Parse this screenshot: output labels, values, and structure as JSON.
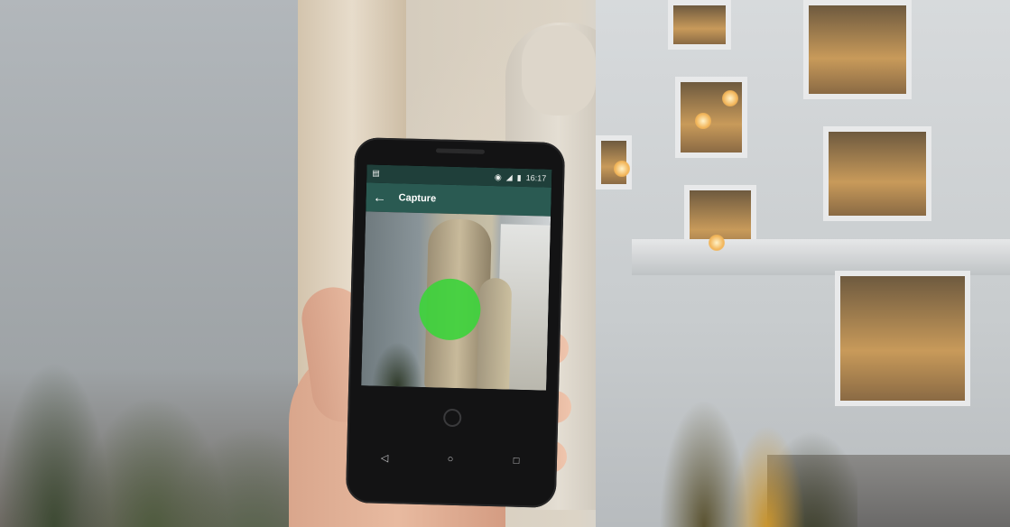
{
  "scene": {
    "description_icon": "photo-background"
  },
  "phone": {
    "status_bar": {
      "time": "16:17",
      "icons": [
        "sim-icon",
        "eye-icon",
        "signal-icon",
        "battery-icon"
      ]
    },
    "app_bar": {
      "back_icon": "←",
      "title": "Capture"
    },
    "camera_view": {
      "target_color": "#3ed33c"
    },
    "nav_bar": {
      "back": "◁",
      "home": "○",
      "recents": "□"
    }
  }
}
